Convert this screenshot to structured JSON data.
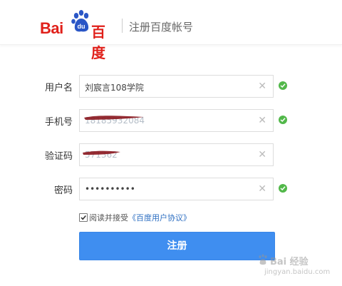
{
  "header": {
    "logo_text": "Bai",
    "logo_paw_text": "du",
    "logo_cn": "百度",
    "title": "注册百度帐号"
  },
  "form": {
    "username": {
      "label": "用户名",
      "value": "刘宸言108学院",
      "valid": true
    },
    "phone": {
      "label": "手机号",
      "value": "18185932084",
      "valid": true,
      "redacted": true
    },
    "code": {
      "label": "验证码",
      "value": "571362",
      "valid": false,
      "redacted": true
    },
    "password": {
      "label": "密码",
      "value": "••••••••••",
      "valid": true
    }
  },
  "agreement": {
    "checked": true,
    "text": "阅读并接受",
    "link": "《百度用户协议》"
  },
  "submit": {
    "label": "注册"
  },
  "watermark": {
    "main": "Bai 经验",
    "sub": "jingyan.baidu.com"
  },
  "colors": {
    "brand_red": "#e0201a",
    "primary_blue": "#3f8ef0",
    "valid_green": "#52b84a",
    "redaction": "#8b1a22"
  },
  "icons": {
    "clear": "close-icon",
    "valid": "check-circle-icon"
  }
}
